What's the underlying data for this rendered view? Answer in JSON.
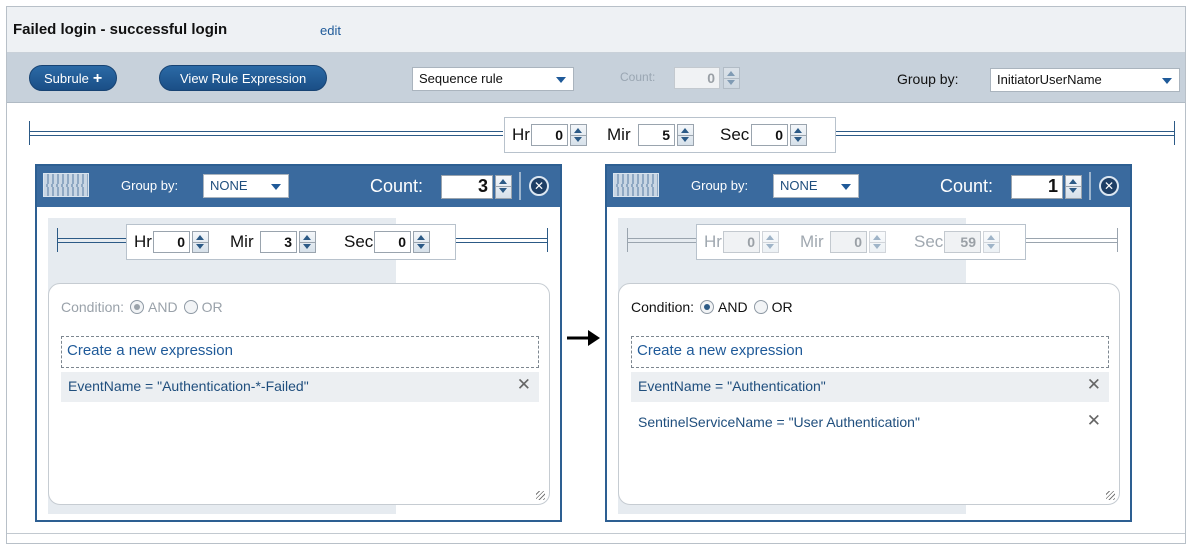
{
  "rule": {
    "title": "Failed login - successful login",
    "edit": "edit"
  },
  "toolbar": {
    "subrule": "Subrule",
    "subrule_plus": "+",
    "view_expr": "View Rule Expression",
    "rule_type": "Sequence rule",
    "count_label": "Count:",
    "count_value": "0",
    "group_by_label": "Group by:",
    "group_by_value": "InitiatorUserName"
  },
  "window": {
    "hr_label": "Hr",
    "hr": "0",
    "min_label": "Mir",
    "min": "5",
    "sec_label": "Sec",
    "sec": "0"
  },
  "subrules": [
    {
      "group_by_label": "Group by:",
      "group_by": "NONE",
      "count_label": "Count:",
      "count": "3",
      "close": "✕",
      "window": {
        "hr_label": "Hr",
        "hr": "0",
        "min_label": "Mir",
        "min": "3",
        "sec_label": "Sec",
        "sec": "0"
      },
      "condition_label": "Condition:",
      "and": "AND",
      "or": "OR",
      "new_expression": "Create a new expression",
      "expressions": [
        "EventName = \"Authentication-*-Failed\""
      ],
      "remove": "✕"
    },
    {
      "group_by_label": "Group by:",
      "group_by": "NONE",
      "count_label": "Count:",
      "count": "1",
      "close": "✕",
      "window": {
        "hr_label": "Hr",
        "hr": "0",
        "min_label": "Mir",
        "min": "0",
        "sec_label": "Sec",
        "sec": "59"
      },
      "condition_label": "Condition:",
      "and": "AND",
      "or": "OR",
      "new_expression": "Create a new expression",
      "expressions": [
        "EventName = \"Authentication\"",
        "SentinelServiceName = \"User Authentication\""
      ],
      "remove": "✕"
    }
  ],
  "icons": {
    "keyboard": "keyboard-icon",
    "spinner": "spinner-icon",
    "close": "close-icon",
    "arrow": "arrow-right-icon",
    "caret": "chevron-down-icon",
    "resize": "resize-handle-icon"
  },
  "colors": {
    "accent": "#2d5f92",
    "header": "#3a6a9e",
    "toolbar": "#c7d1db",
    "link": "#1f5a99"
  }
}
